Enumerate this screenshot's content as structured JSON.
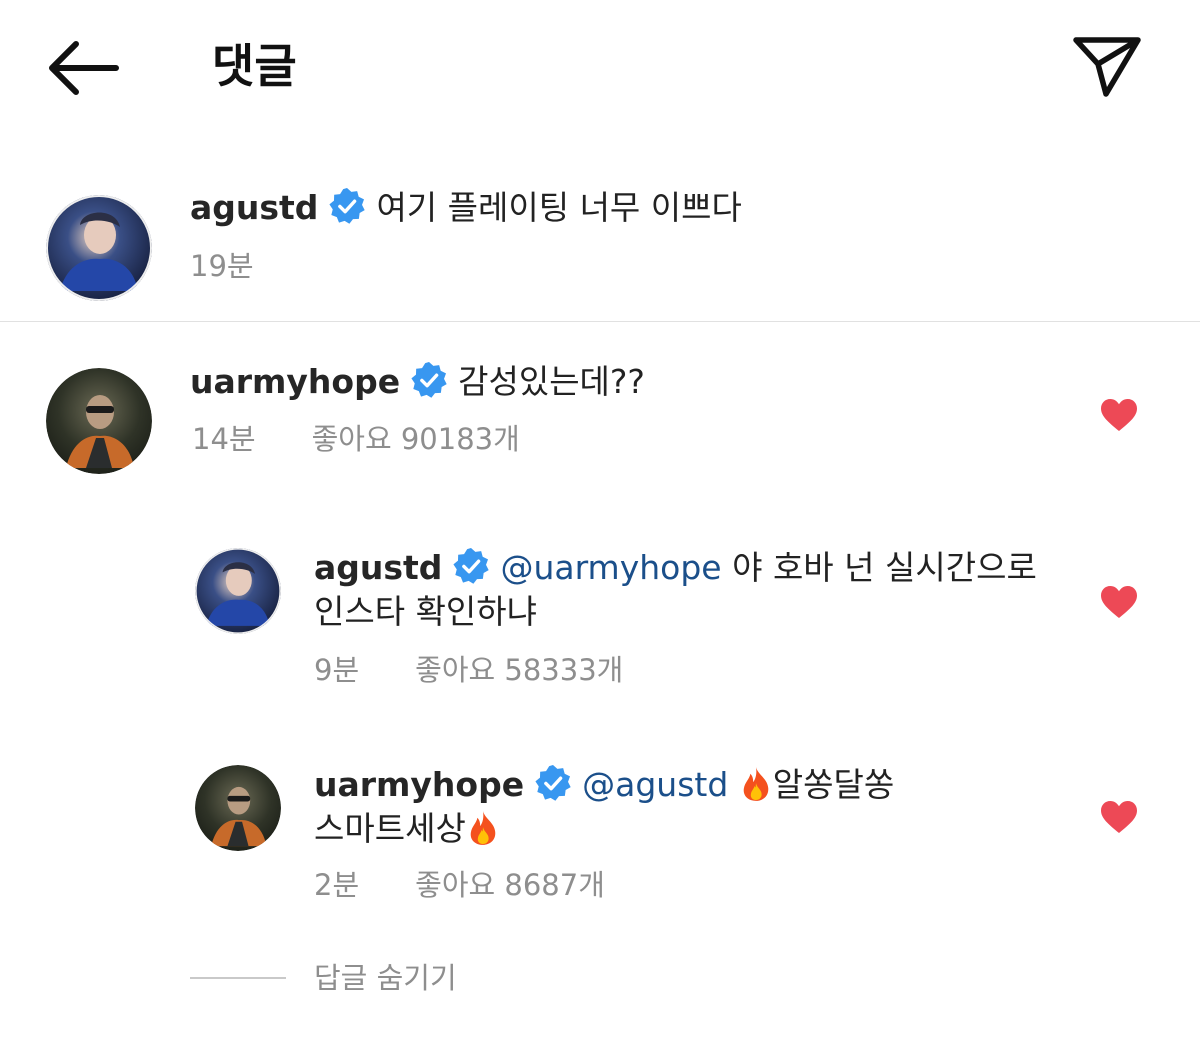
{
  "header": {
    "title": "댓글",
    "back_icon": "arrow-left-icon",
    "share_icon": "paper-plane-icon"
  },
  "colors": {
    "verified": "#3897f0",
    "heart": "#ed4956",
    "mention": "#1b4f8a",
    "meta": "#8e8e8e"
  },
  "post": {
    "username": "agustd",
    "text": "여기 플레이팅 너무 이쁘다",
    "time": "19분"
  },
  "comment": {
    "username": "uarmyhope",
    "text": "감성있는데??",
    "time": "14분",
    "likes": "좋아요 90183개"
  },
  "replies": [
    {
      "username": "agustd",
      "mention": "@uarmyhope",
      "text_line1": "야 호바 넌 실시간으로",
      "text_line2": "인스타 확인하냐",
      "time": "9분",
      "likes": "좋아요 58333개"
    },
    {
      "username": "uarmyhope",
      "mention": "@agustd",
      "text_line1": "알쏭달쏭",
      "text_line2": "스마트세상",
      "time": "2분",
      "likes": "좋아요 8687개"
    }
  ],
  "hide_replies_label": "답글 숨기기"
}
